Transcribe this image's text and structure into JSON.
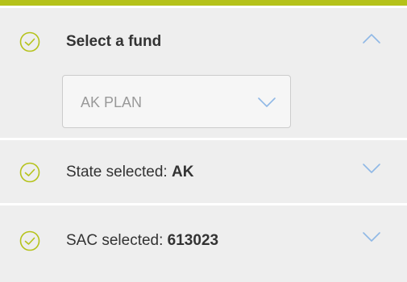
{
  "colors": {
    "accent": "#b5c21a",
    "panel_background": "#eeeeee",
    "chevron": "#8fb8e6"
  },
  "fund_section": {
    "title": "Select a fund",
    "status_icon": "check-circle-icon",
    "toggle_icon": "chevron-up-icon",
    "expanded": true,
    "fund_select": {
      "value": "AK PLAN",
      "icon": "chevron-down-icon"
    }
  },
  "state_section": {
    "label": "State selected: ",
    "value": "AK",
    "status_icon": "check-circle-icon",
    "toggle_icon": "chevron-down-icon",
    "expanded": false
  },
  "sac_section": {
    "label": "SAC selected: ",
    "value": "613023",
    "status_icon": "check-circle-icon",
    "toggle_icon": "chevron-down-icon",
    "expanded": false
  }
}
